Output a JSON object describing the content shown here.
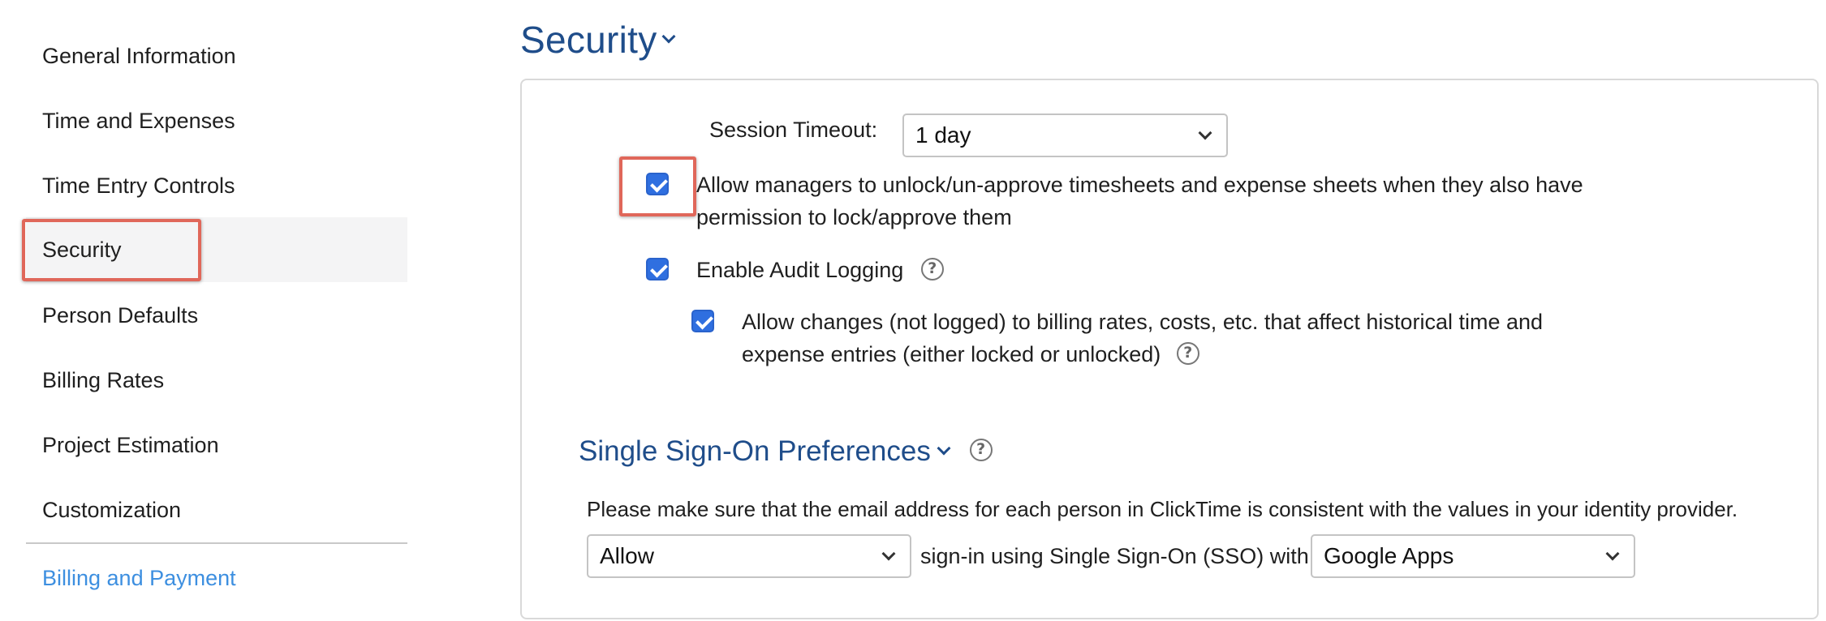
{
  "sidebar": {
    "items": [
      {
        "label": "General Information"
      },
      {
        "label": "Time and Expenses"
      },
      {
        "label": "Time Entry Controls"
      },
      {
        "label": "Security"
      },
      {
        "label": "Person Defaults"
      },
      {
        "label": "Billing Rates"
      },
      {
        "label": "Project Estimation"
      },
      {
        "label": "Customization"
      }
    ],
    "active": "Security",
    "footer_link": "Billing and Payment"
  },
  "main": {
    "title": "Security",
    "session_timeout": {
      "label": "Session Timeout:",
      "value": "1 day"
    },
    "options": {
      "unlock_approve": {
        "checked": true,
        "line1": "Allow managers to unlock/un-approve timesheets and expense sheets when they also have",
        "line2": "permission to lock/approve them"
      },
      "audit_logging": {
        "checked": true,
        "label": "Enable Audit Logging"
      },
      "allow_changes": {
        "checked": true,
        "line1": "Allow changes (not logged) to billing rates, costs, etc. that affect historical time and",
        "line2": "expense entries (either locked or unlocked)"
      }
    },
    "sso": {
      "title": "Single Sign-On Preferences",
      "note": "Please make sure that the email address for each person in ClickTime is consistent with the values in your identity provider.",
      "mode_value": "Allow",
      "connector_text": "sign-in using Single Sign-On (SSO) with",
      "provider_value": "Google Apps"
    }
  },
  "icons": {
    "help": "?"
  },
  "colors": {
    "accent_blue": "#1f4d8a",
    "link_blue": "#3d8fe0",
    "checkbox_blue": "#2f6fe0",
    "highlight_red": "#e0675a"
  }
}
